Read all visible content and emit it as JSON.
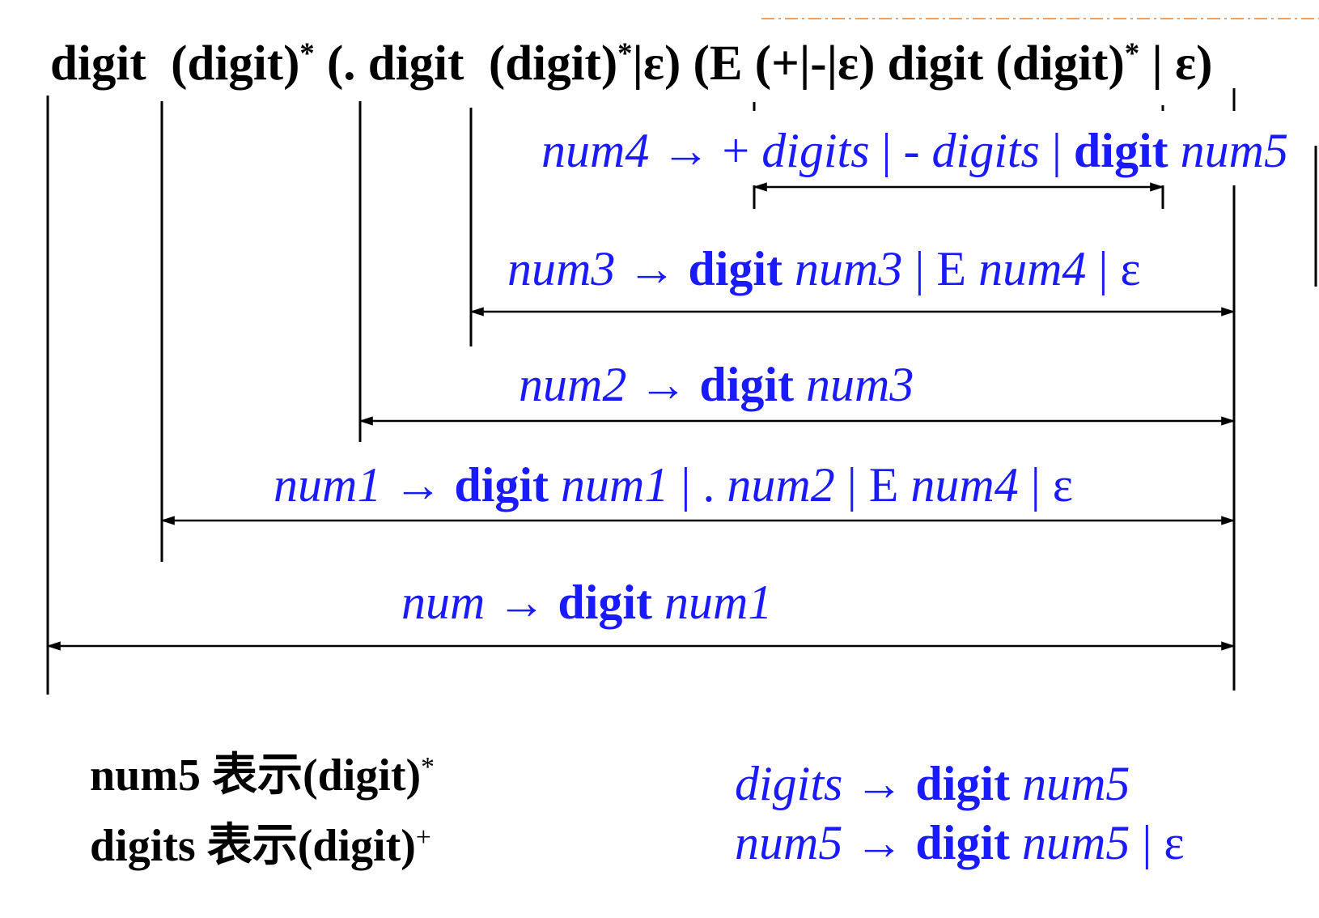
{
  "colors": {
    "regex_text": "#000000",
    "production_text": "#1a1aff",
    "lines": "#000000",
    "header_rule": "#f0a060"
  },
  "regex": [
    {
      "b": "digit  (digit)"
    },
    {
      "sup": "*"
    },
    {
      "b": " (. digit  (digit)"
    },
    {
      "sup": "*"
    },
    {
      "b": "|ε) (E (+|-|ε) digit (digit)"
    },
    {
      "sup": "*"
    },
    {
      "b": " | ε)"
    }
  ],
  "productions": {
    "num4": [
      {
        "i": "num4"
      },
      {
        "t": " → + "
      },
      {
        "i": "digits"
      },
      {
        "t": " | - "
      },
      {
        "i": "digits"
      },
      {
        "t": " | "
      },
      {
        "b": "digit"
      },
      {
        "t": " "
      },
      {
        "i": "num5"
      }
    ],
    "num3": [
      {
        "i": "num3"
      },
      {
        "t": " → "
      },
      {
        "b": "digit"
      },
      {
        "t": " "
      },
      {
        "i": "num3"
      },
      {
        "t": " | E "
      },
      {
        "i": "num4"
      },
      {
        "t": " | ε"
      }
    ],
    "num2": [
      {
        "i": "num2"
      },
      {
        "t": " → "
      },
      {
        "b": "digit"
      },
      {
        "t": " "
      },
      {
        "i": "num3"
      }
    ],
    "num1": [
      {
        "i": "num1"
      },
      {
        "t": " → "
      },
      {
        "b": "digit"
      },
      {
        "t": " "
      },
      {
        "i": "num1"
      },
      {
        "t": " | . "
      },
      {
        "i": "num2"
      },
      {
        "t": " | E "
      },
      {
        "i": "num4"
      },
      {
        "t": " | ε"
      }
    ],
    "num": [
      {
        "i": "num"
      },
      {
        "t": " → "
      },
      {
        "b": "digit"
      },
      {
        "t": " "
      },
      {
        "i": "num1"
      }
    ]
  },
  "notes": [
    [
      {
        "b": "num5 表示(digit)"
      },
      {
        "sup": "*"
      }
    ],
    [
      {
        "b": "digits 表示(digit)"
      },
      {
        "sup": "+"
      }
    ]
  ],
  "aux_productions": {
    "digits": [
      {
        "i": "digits"
      },
      {
        "t": " → "
      },
      {
        "b": "digit"
      },
      {
        "t": " "
      },
      {
        "i": "num5"
      }
    ],
    "num5": [
      {
        "i": "num5"
      },
      {
        "t": " → "
      },
      {
        "b": "digit"
      },
      {
        "t": " "
      },
      {
        "i": "num5"
      },
      {
        "t": " | ε"
      }
    ]
  }
}
